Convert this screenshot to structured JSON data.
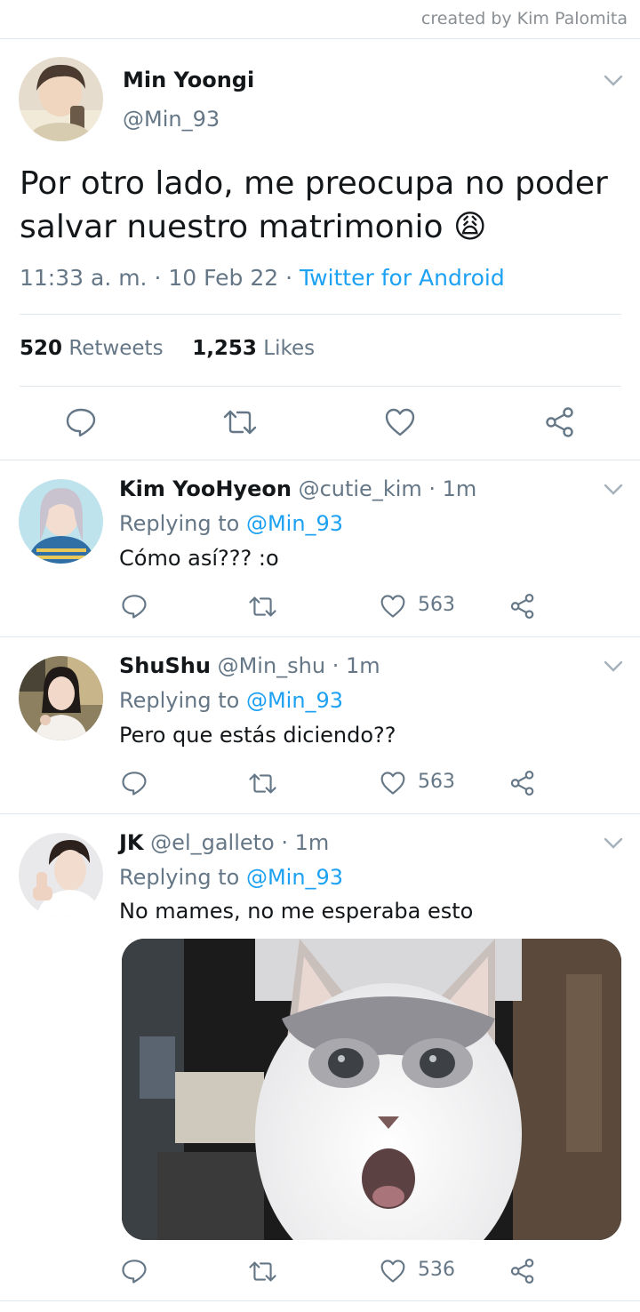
{
  "credit": "created by Kim Palomita",
  "main_tweet": {
    "name": "Min Yoongi",
    "handle": "@Min_93",
    "text_line1": "Por otro lado, me preocupa no poder",
    "text_line2": "salvar nuestro matrimonio",
    "emoji": "😩",
    "time": "11:33 a. m. · 10 Feb 22 ·",
    "source": "Twitter for Android",
    "retweets_count": "520",
    "retweets_label": "Retweets",
    "likes_count": "1,253",
    "likes_label": "Likes"
  },
  "replies": [
    {
      "name": "Kim YooHyeon",
      "meta": "@cutie_kim · 1m",
      "replying_prefix": "Replying to",
      "replying_to": "@Min_93",
      "text": "Cómo así??? :o",
      "likes": "563"
    },
    {
      "name": "ShuShu",
      "meta": "@Min_shu · 1m",
      "replying_prefix": "Replying to",
      "replying_to": "@Min_93",
      "text": "Pero que estás diciendo??",
      "likes": "563"
    },
    {
      "name": "JK",
      "meta": "@el_galleto · 1m",
      "replying_prefix": "Replying to",
      "replying_to": "@Min_93",
      "text": "No mames, no me esperaba esto",
      "likes": "536"
    }
  ],
  "icons": [
    "reply-icon",
    "retweet-icon",
    "like-icon",
    "share-icon",
    "chevron-down-icon"
  ],
  "colors": {
    "link": "#1da1f2",
    "muted": "#657786",
    "divider": "#e1e8ed"
  }
}
